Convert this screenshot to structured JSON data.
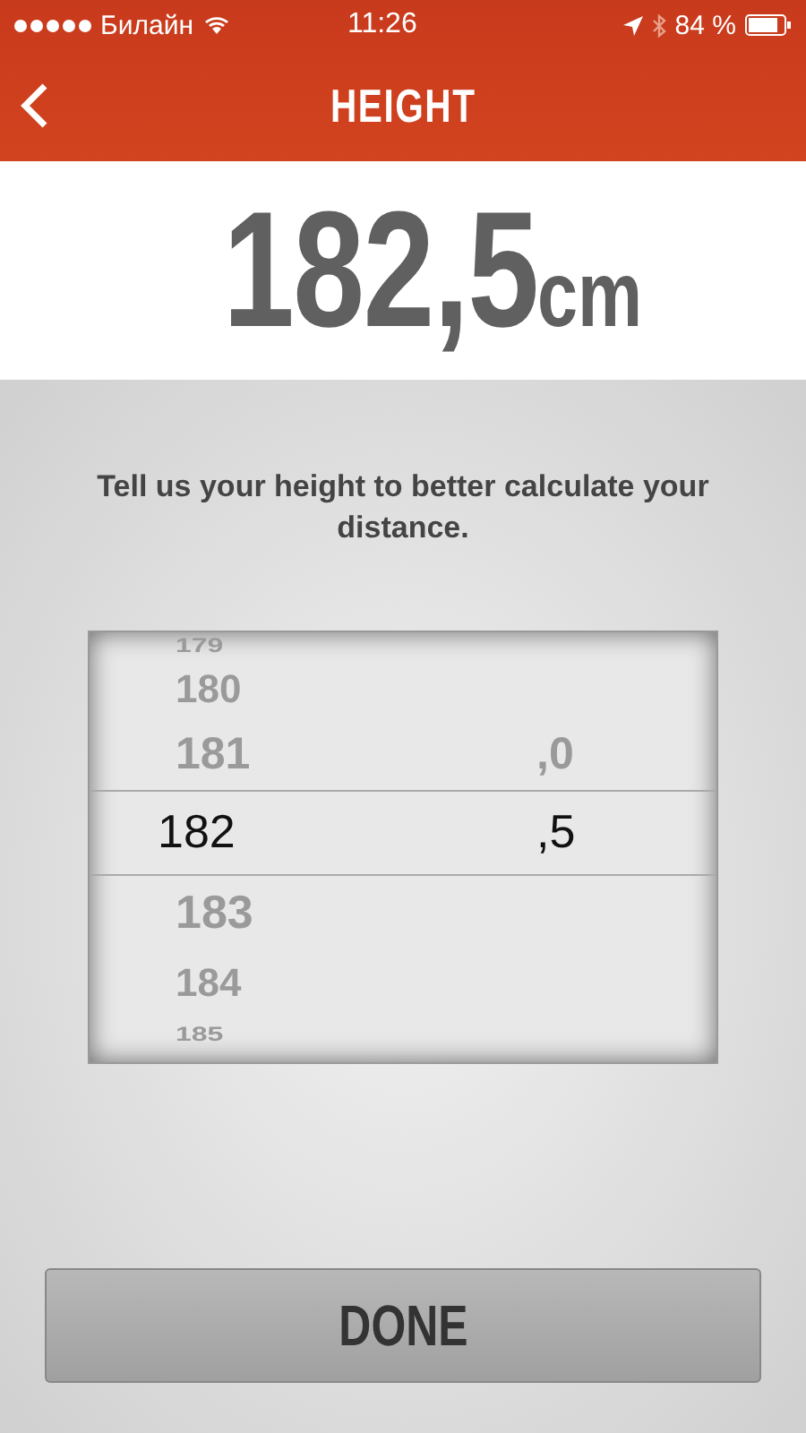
{
  "status_bar": {
    "carrier": "Билайн",
    "time": "11:26",
    "battery": "84 %"
  },
  "nav": {
    "title": "HEIGHT"
  },
  "reading": {
    "value": "182,5",
    "unit": "cm"
  },
  "prompt": "Tell us your height to better calculate your distance.",
  "picker": {
    "wheels": [
      {
        "items": [
          {
            "label": "179",
            "selected": false
          },
          {
            "label": "180",
            "selected": false
          },
          {
            "label": "181",
            "selected": false
          },
          {
            "label": "182",
            "selected": true
          },
          {
            "label": "183",
            "selected": false
          },
          {
            "label": "184",
            "selected": false
          },
          {
            "label": "185",
            "selected": false
          }
        ]
      },
      {
        "items": [
          {
            "label": ",0",
            "selected": false
          },
          {
            "label": ",5",
            "selected": true
          }
        ]
      }
    ]
  },
  "done_button": "DONE"
}
